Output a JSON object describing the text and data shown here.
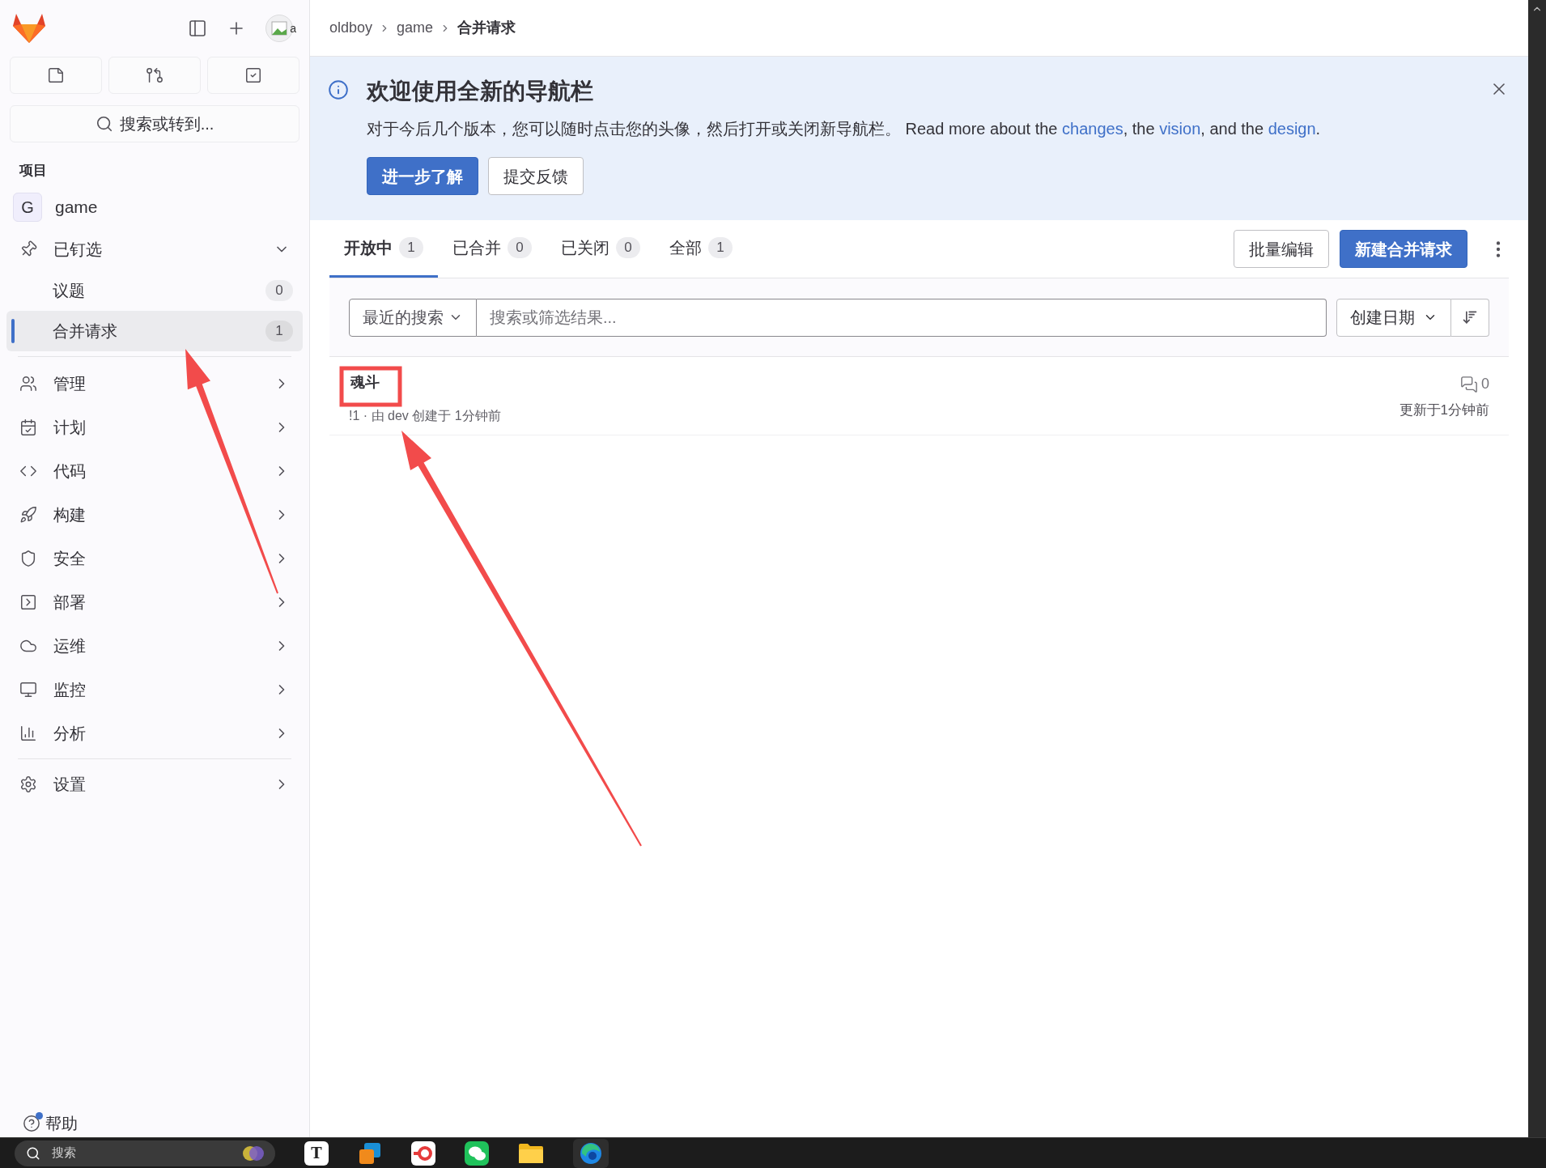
{
  "sidebar": {
    "avatar_alt": "a",
    "search": {
      "placeholder": "搜索或转到..."
    },
    "section_title": "项目",
    "project": {
      "initial": "G",
      "name": "game"
    },
    "pinned": {
      "label": "已钉选",
      "expanded": true,
      "items": [
        {
          "label": "议题",
          "count": "0",
          "selected": false
        },
        {
          "label": "合并请求",
          "count": "1",
          "selected": true
        }
      ]
    },
    "menu": [
      "管理",
      "计划",
      "代码",
      "构建",
      "安全",
      "部署",
      "运维",
      "监控",
      "分析"
    ],
    "settings": "设置",
    "help": "帮助"
  },
  "breadcrumb": [
    "oldboy",
    "game",
    "合并请求"
  ],
  "banner": {
    "title": "欢迎使用全新的导航栏",
    "body": [
      {
        "kind": "text",
        "text": "对于今后几个版本，您可以随时点击您的头像，然后打开或关闭新导航栏。 Read more about the "
      },
      {
        "kind": "link",
        "text": "changes"
      },
      {
        "kind": "text",
        "text": ", the "
      },
      {
        "kind": "link",
        "text": "vision"
      },
      {
        "kind": "text",
        "text": ", and the "
      },
      {
        "kind": "link",
        "text": "design"
      },
      {
        "kind": "text",
        "text": "."
      }
    ],
    "buttons": [
      {
        "label": "进一步了解",
        "kind": "primary"
      },
      {
        "label": "提交反馈",
        "kind": "secondary"
      }
    ]
  },
  "tabs": [
    {
      "label": "开放中",
      "count": "1",
      "selected": true
    },
    {
      "label": "已合并",
      "count": "0",
      "selected": false
    },
    {
      "label": "已关闭",
      "count": "0",
      "selected": false
    },
    {
      "label": "全部",
      "count": "1",
      "selected": false
    }
  ],
  "actions": [
    {
      "label": "批量编辑",
      "kind": "secondary"
    },
    {
      "label": "新建合并请求",
      "kind": "primary"
    }
  ],
  "filter": {
    "recent_label": "最近的搜索",
    "placeholder": "搜索或筛选结果...",
    "sort_label": "创建日期"
  },
  "merge_requests": [
    {
      "title": "魂斗",
      "meta": "!1 · 由 dev 创建于 1分钟前",
      "comments": "0",
      "updated": "更新于1分钟前"
    }
  ],
  "annotations": [
    {
      "kind": "arrow"
    },
    {
      "kind": "arrow"
    },
    {
      "kind": "box"
    }
  ],
  "taskbar": {
    "search_placeholder": "搜索",
    "text_app_label": "T"
  }
}
